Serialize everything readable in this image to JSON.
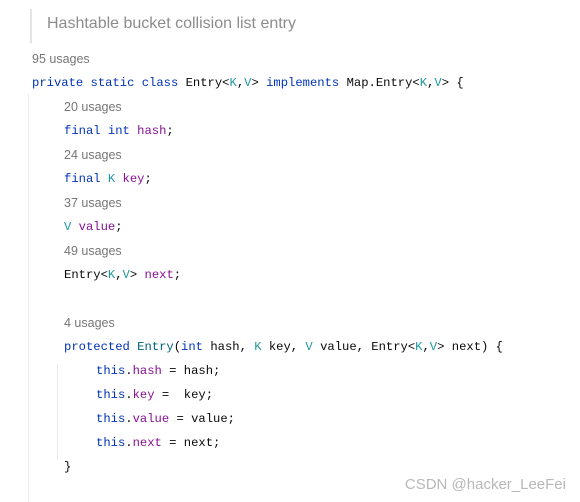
{
  "doc_comment": "Hashtable bucket collision list entry",
  "lines": [
    {
      "type": "usage",
      "indent": 0,
      "text": "95 usages"
    },
    {
      "type": "code",
      "indent": 0,
      "tokens": [
        [
          "kw",
          "private static class "
        ],
        [
          "tx",
          "Entry<"
        ],
        [
          "tp",
          "K"
        ],
        [
          "tx",
          ","
        ],
        [
          "tp",
          "V"
        ],
        [
          "tx",
          "> "
        ],
        [
          "kw",
          "implements "
        ],
        [
          "tx",
          "Map.Entry<"
        ],
        [
          "tp",
          "K"
        ],
        [
          "tx",
          ","
        ],
        [
          "tp",
          "V"
        ],
        [
          "tx",
          "> {"
        ]
      ]
    },
    {
      "type": "usage",
      "indent": 1,
      "text": "20 usages"
    },
    {
      "type": "code",
      "indent": 1,
      "tokens": [
        [
          "kw",
          "final int "
        ],
        [
          "fd",
          "hash"
        ],
        [
          "tx",
          ";"
        ]
      ]
    },
    {
      "type": "usage",
      "indent": 1,
      "text": "24 usages"
    },
    {
      "type": "code",
      "indent": 1,
      "tokens": [
        [
          "kw",
          "final "
        ],
        [
          "tp",
          "K "
        ],
        [
          "fd",
          "key"
        ],
        [
          "tx",
          ";"
        ]
      ]
    },
    {
      "type": "usage",
      "indent": 1,
      "text": "37 usages"
    },
    {
      "type": "code",
      "indent": 1,
      "tokens": [
        [
          "tp",
          "V "
        ],
        [
          "fd",
          "value"
        ],
        [
          "tx",
          ";"
        ]
      ]
    },
    {
      "type": "usage",
      "indent": 1,
      "text": "49 usages"
    },
    {
      "type": "code",
      "indent": 1,
      "tokens": [
        [
          "tx",
          "Entry<"
        ],
        [
          "tp",
          "K"
        ],
        [
          "tx",
          ","
        ],
        [
          "tp",
          "V"
        ],
        [
          "tx",
          "> "
        ],
        [
          "fd",
          "next"
        ],
        [
          "tx",
          ";"
        ]
      ]
    },
    {
      "type": "blank",
      "indent": 0
    },
    {
      "type": "usage",
      "indent": 1,
      "text": "4 usages"
    },
    {
      "type": "code",
      "indent": 1,
      "tokens": [
        [
          "kw",
          "protected "
        ],
        [
          "fn",
          "Entry"
        ],
        [
          "tx",
          "("
        ],
        [
          "kw",
          "int "
        ],
        [
          "tx",
          "hash, "
        ],
        [
          "tp",
          "K "
        ],
        [
          "tx",
          "key, "
        ],
        [
          "tp",
          "V "
        ],
        [
          "tx",
          "value, Entry<"
        ],
        [
          "tp",
          "K"
        ],
        [
          "tx",
          ","
        ],
        [
          "tp",
          "V"
        ],
        [
          "tx",
          "> next) {"
        ]
      ]
    },
    {
      "type": "code",
      "indent": 2,
      "tokens": [
        [
          "kw",
          "this"
        ],
        [
          "tx",
          "."
        ],
        [
          "fd",
          "hash"
        ],
        [
          "tx",
          " = hash;"
        ]
      ]
    },
    {
      "type": "code",
      "indent": 2,
      "tokens": [
        [
          "kw",
          "this"
        ],
        [
          "tx",
          "."
        ],
        [
          "fd",
          "key"
        ],
        [
          "tx",
          " =  key;"
        ]
      ]
    },
    {
      "type": "code",
      "indent": 2,
      "tokens": [
        [
          "kw",
          "this"
        ],
        [
          "tx",
          "."
        ],
        [
          "fd",
          "value"
        ],
        [
          "tx",
          " = value;"
        ]
      ]
    },
    {
      "type": "code",
      "indent": 2,
      "tokens": [
        [
          "kw",
          "this"
        ],
        [
          "tx",
          "."
        ],
        [
          "fd",
          "next"
        ],
        [
          "tx",
          " = next;"
        ]
      ]
    },
    {
      "type": "code",
      "indent": 1,
      "tokens": [
        [
          "tx",
          "}"
        ]
      ]
    }
  ],
  "watermark": "CSDN @hacker_LeeFei",
  "colors": {
    "keyword": "#0033b3",
    "type_param": "#20999d",
    "field": "#871094",
    "usage": "#767676",
    "doc": "#8c8c8c"
  }
}
